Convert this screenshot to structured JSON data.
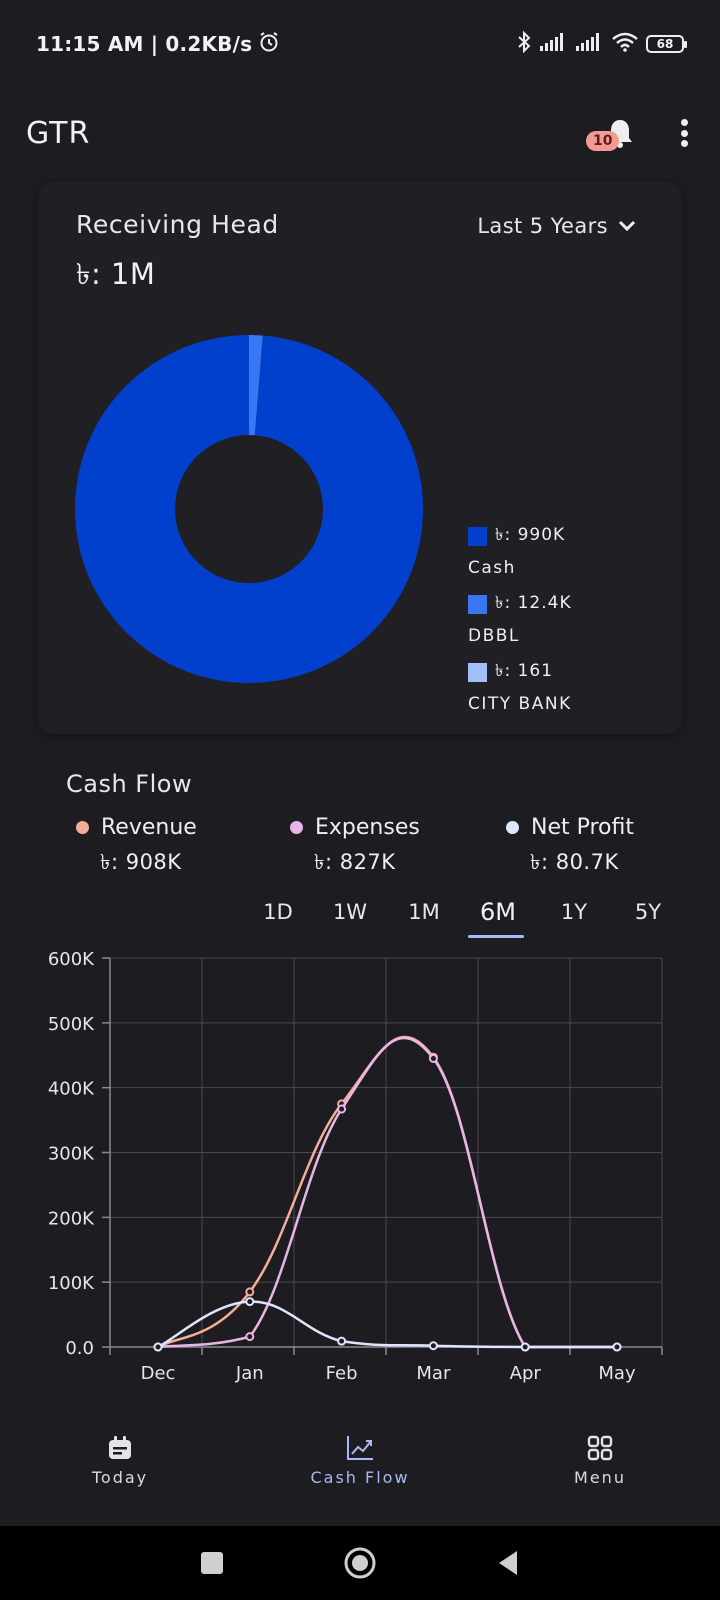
{
  "status_bar": {
    "time_speed": "11:15 AM | 0.2KB/s",
    "battery": "68",
    "icons": [
      "alarm-icon",
      "bluetooth-icon",
      "signal-icon",
      "signal-icon",
      "wifi-icon",
      "battery-icon"
    ]
  },
  "app_bar": {
    "title": "GTR",
    "notification_count": "10"
  },
  "receiving_head": {
    "title": "Receiving Head",
    "total": "৳: 1M",
    "range": "Last 5 Years",
    "slices": [
      {
        "value_label": "৳: 990K",
        "name": "Cash",
        "value": 990000,
        "color": "#0040cc"
      },
      {
        "value_label": "৳: 12.4K",
        "name": "DBBL",
        "value": 12400,
        "color": "#3b76f2"
      },
      {
        "value_label": "৳: 161",
        "name": "CITY BANK",
        "value": 161,
        "color": "#a3bff8"
      }
    ]
  },
  "cash_flow": {
    "title": "Cash Flow",
    "stats": [
      {
        "label": "Revenue",
        "value": "৳: 908K",
        "color": "#f6ad9a"
      },
      {
        "label": "Expenses",
        "value": "৳: 827K",
        "color": "#e7b6e6"
      },
      {
        "label": "Net Profit",
        "value": "৳: 80.7K",
        "color": "#dde6fb"
      }
    ],
    "tabs": [
      "1D",
      "1W",
      "1M",
      "6M",
      "1Y",
      "5Y"
    ],
    "active_tab": "6M"
  },
  "chart_data": {
    "type": "line",
    "x": [
      "Dec",
      "Jan",
      "Feb",
      "Mar",
      "Apr",
      "May"
    ],
    "yticks": [
      "0.0",
      "100K",
      "200K",
      "300K",
      "400K",
      "500K",
      "600K"
    ],
    "ylim": [
      0,
      600000
    ],
    "grid": true,
    "series": [
      {
        "name": "Revenue",
        "color": "#f6ad9a",
        "values": [
          0,
          85000,
          375000,
          447000,
          0,
          0
        ]
      },
      {
        "name": "Expenses",
        "color": "#e7b6e6",
        "values": [
          0,
          16000,
          367000,
          445000,
          0,
          0
        ]
      },
      {
        "name": "Net Profit",
        "color": "#dde6fb",
        "values": [
          0,
          70000,
          9000,
          2000,
          0,
          0
        ]
      }
    ]
  },
  "bottom_nav": {
    "items": [
      {
        "label": "Today",
        "icon": "calendar-icon"
      },
      {
        "label": "Cash Flow",
        "icon": "chart-line-icon"
      },
      {
        "label": "Menu",
        "icon": "grid-icon"
      }
    ],
    "active": "Cash Flow"
  }
}
